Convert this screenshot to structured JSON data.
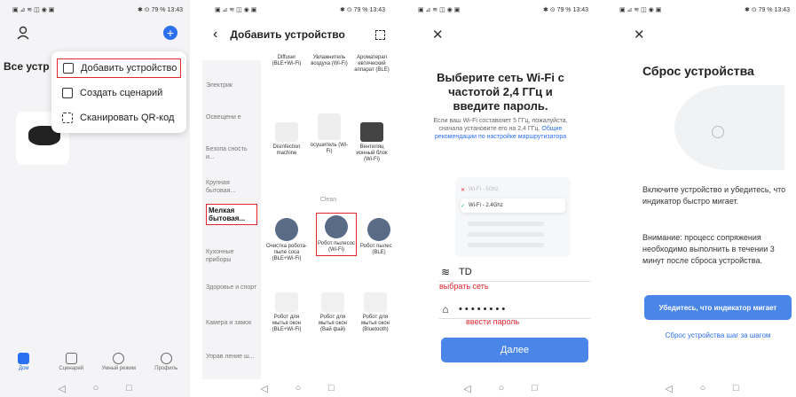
{
  "status_left": "▣ ⊿ ≋ ◫ ◉ ▣",
  "status_right": "✱ ⊙ 79 % 13:43",
  "nav": {
    "back": "◁",
    "home": "○",
    "recent": "□"
  },
  "screen1": {
    "all_devices": "Все устр",
    "menu": [
      "Добавить устройство",
      "Создать сценарий",
      "Сканировать QR-код"
    ],
    "tabs": [
      "Дом",
      "Сценарий",
      "Умный режим",
      "Профиль"
    ]
  },
  "screen2": {
    "title": "Добавить устройство",
    "categories": [
      "Электрик",
      "Освещени е",
      "Безопа сность и...",
      "Крупная бытовая...",
      "Мелкая бытовая...",
      "Кухонные приборы",
      "Здоровье и спорт",
      "Камера и замок",
      "Управ ление ш..."
    ],
    "section_label": "Clean",
    "products": [
      "Diffuser (BLE+Wi-Fi)",
      "Увлажнитель воздуха (Wi-Fi)",
      "Ароматерап евтический аппарат (BLE)",
      "Disinfection machine",
      "осушитель (Wi-Fi)",
      "Вентиляц ионный блок (Wi-Fi)",
      "Очистка робота-пыле coca (BLE+Wi-Fi)",
      "Робот пылесос (Wi-Fi)",
      "Робот пылесос (BLE)",
      "Робот для мытья окон (BLE+Wi-Fi)",
      "Робот для мытья окон (Вай фай)",
      "Робот для мытья окон (Bluetooth)"
    ]
  },
  "screen3": {
    "title": "Выберите сеть Wi-Fi с частотой 2,4 ГГц и введите пароль.",
    "desc": "Если ваш Wi-Fi составляет 5 ГГц, пожалуйста, сначала установите его на 2,4 ГГц.",
    "desc_link": "Общие рекомендации по настройке маршрутизатора",
    "wifi_bad": "Wi-Fi - 5Ghz",
    "wifi_good": "Wi-Fi - 2.4Ghz",
    "network_value": "TD",
    "network_note": "выбрать сеть",
    "password_value": "• • • • • • • •",
    "password_note": "ввести пароль",
    "next_button": "Далее"
  },
  "screen4": {
    "title": "Сброс устройства",
    "text1": "Включите устройство и убедитесь, что индикатор быстро мигает.",
    "text2": "Внимание: процесс сопряжения необходимо выполнить в течении 3 минут после сброса устройства.",
    "button": "Убедитесь, что индикатор мигает",
    "link": "Сброс устройства шаг за шагом"
  }
}
